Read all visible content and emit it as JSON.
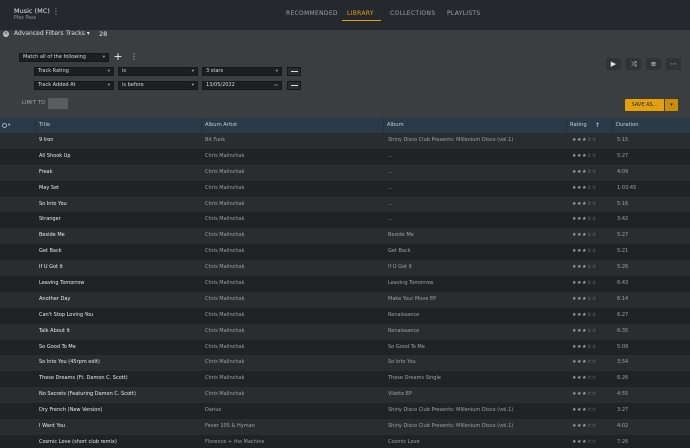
{
  "header": {
    "library_name": "Music (MC)",
    "library_sub": "Plex Pass",
    "nav": [
      {
        "label": "RECOMMENDED",
        "active": false
      },
      {
        "label": "LIBRARY",
        "active": true
      },
      {
        "label": "COLLECTIONS",
        "active": false
      },
      {
        "label": "PLAYLISTS",
        "active": false
      }
    ]
  },
  "filters": {
    "title": "Advanced Filters",
    "type_label": "Tracks",
    "count": "28",
    "match_label": "Match all of the following",
    "rules": [
      {
        "field": "Track Rating",
        "operator": "is",
        "value": "3 stars"
      },
      {
        "field": "Track Added At",
        "operator": "is before",
        "value": "13/05/2022"
      }
    ],
    "limit_label": "LIMIT TO",
    "limit_value": "",
    "save_label": "SAVE AS...",
    "toolbar_icons": [
      "play-icon",
      "shuffle-icon",
      "add-to-playlist-icon",
      "more-icon"
    ]
  },
  "table": {
    "columns": {
      "title": "Title",
      "artist": "Album Artist",
      "album": "Album",
      "rating": "Rating",
      "duration": "Duration"
    },
    "sort_icon": "arrow-up-icon",
    "rows": [
      {
        "title": "9 Iron",
        "artist": "Bit Funk",
        "album": "Shiny Disco Club Presents: Millenium Disco (vol.1)",
        "rating": "★★★☆☆",
        "duration": "5:15"
      },
      {
        "title": "All Shook Up",
        "artist": "Chris Malinchak",
        "album": "...",
        "rating": "★★★☆☆",
        "duration": "5:27"
      },
      {
        "title": "Freak",
        "artist": "Chris Malinchak",
        "album": "...",
        "rating": "★★★☆☆",
        "duration": "4:09"
      },
      {
        "title": "May Set",
        "artist": "Chris Malinchak",
        "album": "...",
        "rating": "★★★☆☆",
        "duration": "1:03:45"
      },
      {
        "title": "So Into You",
        "artist": "Chris Malinchak",
        "album": "...",
        "rating": "★★★☆☆",
        "duration": "5:16"
      },
      {
        "title": "Stranger",
        "artist": "Chris Malinchak",
        "album": "...",
        "rating": "★★★☆☆",
        "duration": "3:42"
      },
      {
        "title": "Beside Me",
        "artist": "Chris Malinchak",
        "album": "Beside Me",
        "rating": "★★★☆☆",
        "duration": "5:27"
      },
      {
        "title": "Get Back",
        "artist": "Chris Malinchak",
        "album": "Get Back",
        "rating": "★★★☆☆",
        "duration": "5:21"
      },
      {
        "title": "If U Got It",
        "artist": "Chris Malinchak",
        "album": "If U Got It",
        "rating": "★★★☆☆",
        "duration": "5:26"
      },
      {
        "title": "Leaving Tomorrow",
        "artist": "Chris Malinchak",
        "album": "Leaving Tomorrow",
        "rating": "★★★☆☆",
        "duration": "6:43"
      },
      {
        "title": "Another Day",
        "artist": "Chris Malinchak",
        "album": "Make Your Move EP",
        "rating": "★★★☆☆",
        "duration": "6:14"
      },
      {
        "title": "Can't Stop Loving You",
        "artist": "Chris Malinchak",
        "album": "Renaissance",
        "rating": "★★★☆☆",
        "duration": "6:27"
      },
      {
        "title": "Talk About It",
        "artist": "Chris Malinchak",
        "album": "Renaissance",
        "rating": "★★★☆☆",
        "duration": "6:35"
      },
      {
        "title": "So Good To Me",
        "artist": "Chris Malinchak",
        "album": "So Good To Me",
        "rating": "★★★☆☆",
        "duration": "5:09"
      },
      {
        "title": "So Into You (45rpm edit)",
        "artist": "Chris Malinchak",
        "album": "So Into You",
        "rating": "★★★☆☆",
        "duration": "3:54"
      },
      {
        "title": "These Dreams (Ft. Damon C. Scott)",
        "artist": "Chris Malinchak",
        "album": "These Dreams Single",
        "rating": "★★★☆☆",
        "duration": "6:26"
      },
      {
        "title": "No Secrets (Featuring Damon C. Scott)",
        "artist": "Chris Malinchak",
        "album": "Vilette EP",
        "rating": "★★★☆☆",
        "duration": "4:55"
      },
      {
        "title": "Dry French (New Version)",
        "artist": "Darius",
        "album": "Shiny Disco Club Presents: Millenium Disco (vol.1)",
        "rating": "★★★☆☆",
        "duration": "3:27"
      },
      {
        "title": "I Want You",
        "artist": "Fever 105 & Hyman",
        "album": "Shiny Disco Club Presents: Millenium Disco (vol.1)",
        "rating": "★★★☆☆",
        "duration": "4:02"
      },
      {
        "title": "Cosmic Love (short club remix)",
        "artist": "Florence + the Machine",
        "album": "Cosmic Love",
        "rating": "★★★☆☆",
        "duration": "7:26"
      }
    ]
  }
}
